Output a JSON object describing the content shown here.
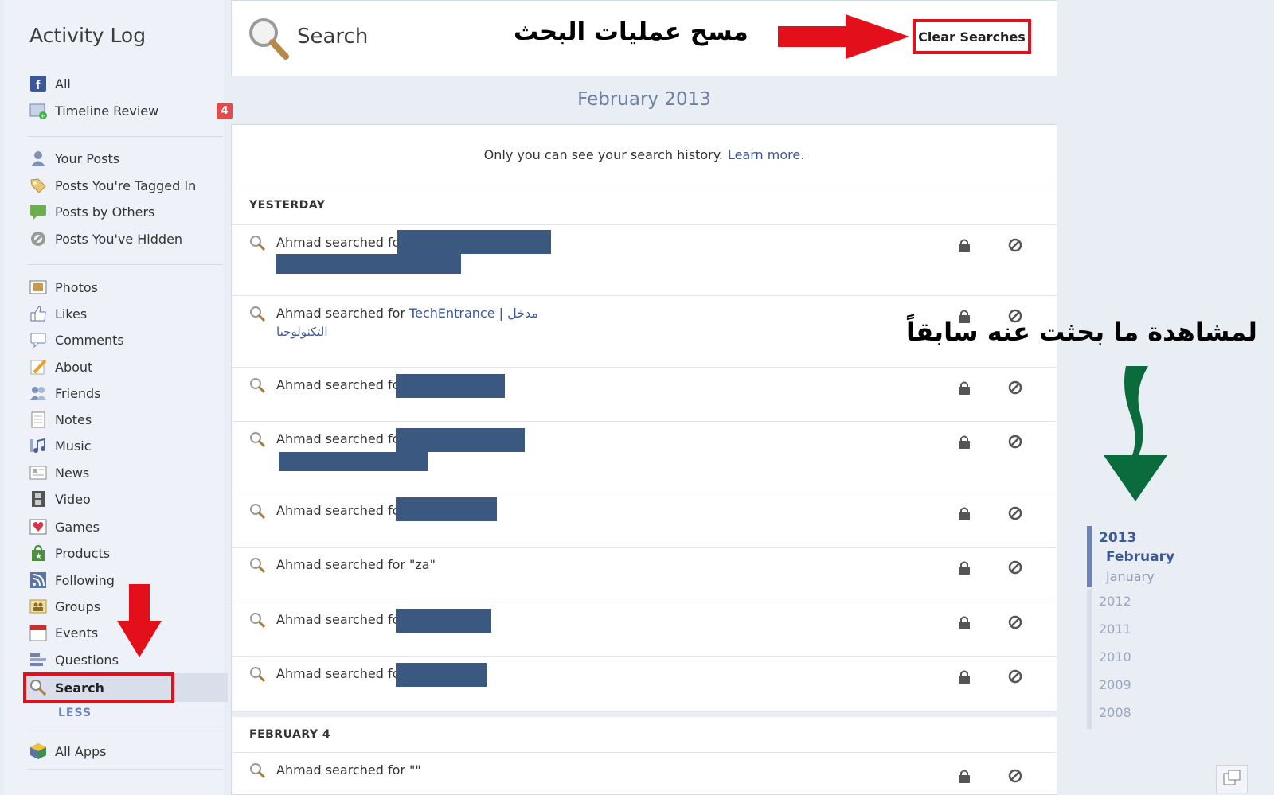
{
  "sidebar": {
    "title": "Activity Log",
    "items": [
      {
        "label": "All",
        "icon": "facebook-icon"
      },
      {
        "label": "Timeline Review",
        "icon": "timeline-review-icon",
        "badge": "4"
      },
      {
        "label": "Your Posts",
        "icon": "user-icon"
      },
      {
        "label": "Posts You're Tagged In",
        "icon": "tag-icon"
      },
      {
        "label": "Posts by Others",
        "icon": "speech-bubble-icon"
      },
      {
        "label": "Posts You've Hidden",
        "icon": "hidden-icon"
      },
      {
        "label": "Photos",
        "icon": "photo-icon"
      },
      {
        "label": "Likes",
        "icon": "thumbs-up-icon"
      },
      {
        "label": "Comments",
        "icon": "comment-icon"
      },
      {
        "label": "About",
        "icon": "pencil-icon"
      },
      {
        "label": "Friends",
        "icon": "friends-icon"
      },
      {
        "label": "Notes",
        "icon": "note-icon"
      },
      {
        "label": "Music",
        "icon": "music-icon"
      },
      {
        "label": "News",
        "icon": "news-icon"
      },
      {
        "label": "Video",
        "icon": "film-icon"
      },
      {
        "label": "Games",
        "icon": "games-icon"
      },
      {
        "label": "Products",
        "icon": "bag-icon"
      },
      {
        "label": "Following",
        "icon": "rss-icon"
      },
      {
        "label": "Groups",
        "icon": "groups-icon"
      },
      {
        "label": "Events",
        "icon": "calendar-icon"
      },
      {
        "label": "Questions",
        "icon": "questions-icon"
      },
      {
        "label": "Search",
        "icon": "search-icon",
        "selected": true
      },
      {
        "label": "All Apps",
        "icon": "apps-cube-icon"
      }
    ],
    "less_label": "LESS"
  },
  "header": {
    "title": "Search",
    "clear_label": "Clear Searches",
    "annotation_arabic": "مسح عمليات البحث"
  },
  "month_heading": "February 2013",
  "notice": {
    "text": "Only you can see your search history.",
    "link": "Learn more."
  },
  "sections": {
    "yesterday": "YESTERDAY",
    "feb4": "FEBRUARY 4"
  },
  "rows": [
    {
      "text": "Ahmad searched for"
    },
    {
      "text": "Ahmad searched for",
      "link": "TechEntrance | مدخل",
      "link2": "التكنولوجيا"
    },
    {
      "text": "Ahmad searched for"
    },
    {
      "text": "Ahmad searched for"
    },
    {
      "text": "Ahmad searched for"
    },
    {
      "text": "Ahmad searched for \"za\""
    },
    {
      "text": "Ahmad searched for"
    },
    {
      "text": "Ahmad searched for"
    },
    {
      "text": "Ahmad searched for \"\""
    }
  ],
  "annotation_arabic_2": "لمشاهدة ما بحثت عنه سابقاً",
  "timeline": {
    "year_2013": "2013",
    "february": "February",
    "january": "January",
    "years": [
      "2012",
      "2011",
      "2010",
      "2009",
      "2008"
    ]
  },
  "colors": {
    "accent": "#3b5998",
    "red_annotation": "#e3101b",
    "green_annotation": "#0a6b3c",
    "redaction": "#3b5880"
  }
}
